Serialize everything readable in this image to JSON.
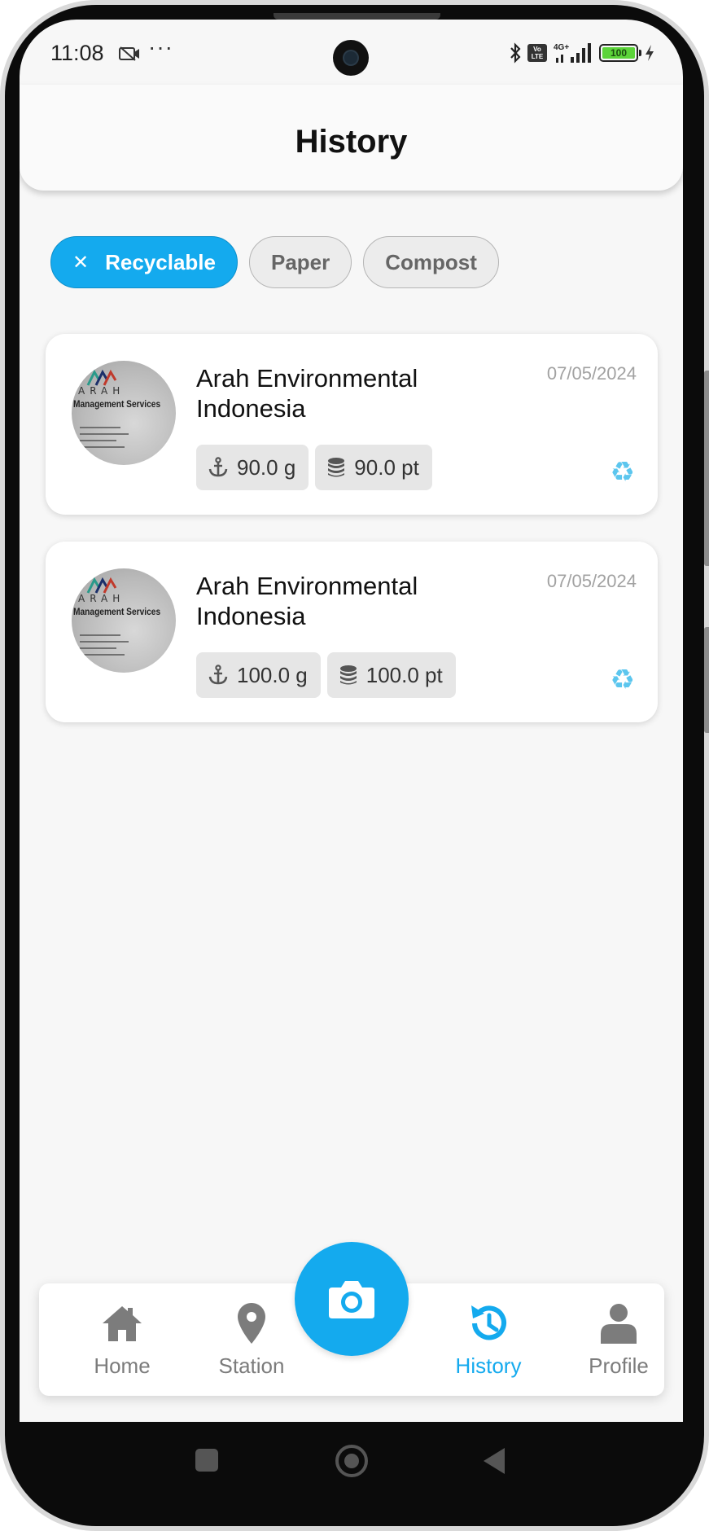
{
  "status_bar": {
    "time": "11:08",
    "dots": "···",
    "battery": "100",
    "network": "4G+"
  },
  "header": {
    "title": "History"
  },
  "filters": [
    {
      "label": "Recyclable",
      "active": true
    },
    {
      "label": "Paper",
      "active": false
    },
    {
      "label": "Compost",
      "active": false
    }
  ],
  "history": [
    {
      "name": "Arah Environmental Indonesia",
      "date": "07/05/2024",
      "weight": "90.0 g",
      "points": "90.0 pt",
      "category_icon": "recycle-icon"
    },
    {
      "name": "Arah Environmental Indonesia",
      "date": "07/05/2024",
      "weight": "100.0 g",
      "points": "100.0 pt",
      "category_icon": "recycle-icon"
    }
  ],
  "avatar_logo": {
    "line1": "ARAH",
    "line2": "Management Services"
  },
  "bottom_nav": {
    "items": [
      {
        "label": "Home",
        "icon": "home-icon"
      },
      {
        "label": "Station",
        "icon": "location-pin-icon"
      },
      {
        "label": "History",
        "icon": "history-icon",
        "active": true
      },
      {
        "label": "Profile",
        "icon": "user-icon"
      }
    ],
    "fab_icon": "camera-icon"
  },
  "colors": {
    "accent": "#14aaee",
    "recycle": "#5cc6ee",
    "background": "#f7f7f7"
  }
}
